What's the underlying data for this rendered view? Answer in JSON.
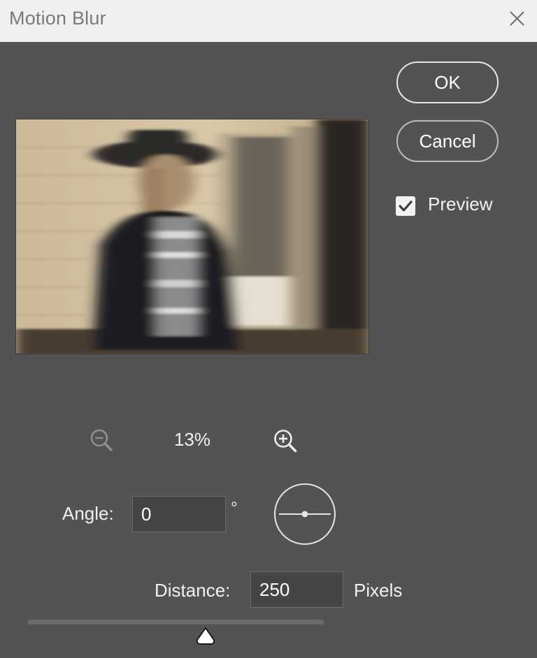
{
  "window": {
    "title": "Motion Blur"
  },
  "buttons": {
    "ok": "OK",
    "cancel": "Cancel"
  },
  "preview": {
    "label": "Preview",
    "checked": true
  },
  "zoom": {
    "level": "13%"
  },
  "angle": {
    "label": "Angle:",
    "value": "0",
    "unit": "°"
  },
  "distance": {
    "label": "Distance:",
    "value": "250",
    "unit": "Pixels"
  },
  "distance_slider": {
    "fraction": 0.6
  },
  "colors": {
    "background": "#535353",
    "titlebar": "#f0f0f0",
    "text": "#f0f0f0",
    "input_bg": "#454545"
  },
  "icons": {
    "close": "close-icon",
    "zoom_out": "zoom-out-icon",
    "zoom_in": "zoom-in-icon",
    "check": "checkmark-icon",
    "dial": "angle-dial-icon"
  }
}
